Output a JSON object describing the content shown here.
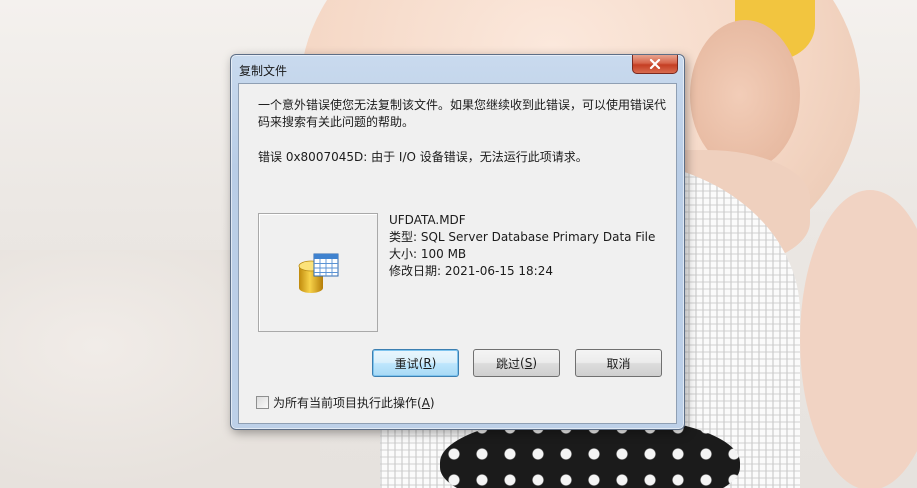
{
  "dialog": {
    "title": "复制文件",
    "message": "一个意外错误使您无法复制该文件。如果您继续收到此错误，可以使用错误代码来搜索有关此问题的帮助。",
    "error_prefix": "错误 0x8007045D: 由于 I/O 设备错误，无法运行此项请求。",
    "file": {
      "name": "UFDATA.MDF",
      "type_line": "类型: SQL Server Database Primary Data File",
      "size_line": "大小: 100 MB",
      "modified_line": "修改日期: 2021-06-15 18:24",
      "icon": "sql-database-file-icon"
    },
    "buttons": {
      "retry": {
        "label": "重试",
        "mnemonic": "R"
      },
      "skip": {
        "label": "跳过",
        "mnemonic": "S"
      },
      "cancel": {
        "label": "取消"
      }
    },
    "checkbox": {
      "label": "为所有当前项目执行此操作",
      "mnemonic": "A",
      "checked": false
    },
    "close_icon": "close-icon"
  },
  "colors": {
    "titlebar": "#c9daee",
    "close_button": "#c53e23",
    "client_bg": "#f0f0f0",
    "default_button_border": "#3c7fb1"
  }
}
